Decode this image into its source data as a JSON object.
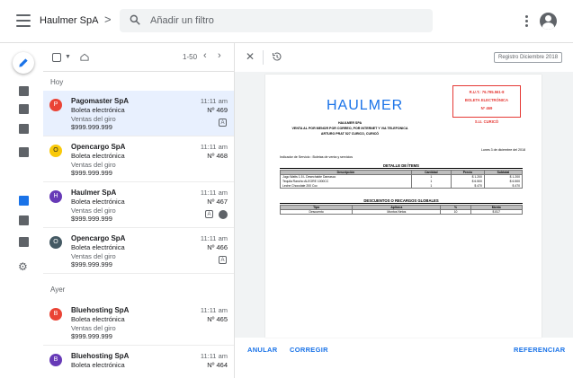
{
  "app": {
    "company": "Haulmer SpA",
    "breadcrumb_chevron": ">",
    "search_placeholder": "Añadir un filtro"
  },
  "colors": {
    "accent": "#1a73e8",
    "selected_row": "#e8f0fe",
    "doc_red": "#e53935"
  },
  "rail_icons": [
    "pencil-icon",
    "inbox-down-icon",
    "inbox-up-icon",
    "archive-icon",
    "report-icon",
    "document-folder-icon",
    "document-list-icon",
    "document-export-icon",
    "gear-icon"
  ],
  "list": {
    "pager": "1-50",
    "sections": [
      "Hoy",
      "Ayer"
    ],
    "items": [
      {
        "initial": "P",
        "sender": "Pagomaster SpA",
        "subject": "Boleta electrónica",
        "desc": "Ventas del giro",
        "amount": "$999.999.999",
        "time": "11:11 am",
        "num": "Nº 469",
        "color": "#ea4335",
        "badge": "A"
      },
      {
        "initial": "O",
        "sender": "Opencargo SpA",
        "subject": "Boleta electrónica",
        "desc": "Ventas del giro",
        "amount": "$999.999.999",
        "time": "11:11 am",
        "num": "Nº 468",
        "color": "#f9c909",
        "badge": ""
      },
      {
        "initial": "H",
        "sender": "Haulmer SpA",
        "subject": "Boleta electrónica",
        "desc": "Ventas del giro",
        "amount": "$999.999.999",
        "time": "11:11 am",
        "num": "Nº 467",
        "color": "#673ab7",
        "badge": "A"
      },
      {
        "initial": "O",
        "sender": "Opencargo SpA",
        "subject": "Boleta electrónica",
        "desc": "Ventas del giro",
        "amount": "$999.999.999",
        "time": "11:11 am",
        "num": "Nº 466",
        "color": "#455a64",
        "badge": "A"
      },
      {
        "initial": "B",
        "sender": "Bluehosting SpA",
        "subject": "Boleta electrónica",
        "desc": "Ventas del giro",
        "amount": "$999.999.999",
        "time": "11:11 am",
        "num": "Nº 465",
        "color": "#ea4335",
        "badge": ""
      },
      {
        "initial": "B",
        "sender": "Bluehosting SpA",
        "subject": "Boleta electrónica",
        "desc": "",
        "amount": "",
        "time": "11:11 am",
        "num": "Nº 464",
        "color": "#673ab7",
        "badge": ""
      }
    ]
  },
  "detail": {
    "registro": "Registro Diciembre 2018",
    "actions": {
      "anular": "ANULAR",
      "corregir": "CORREGIR",
      "referenciar": "REFERENCIAR"
    }
  },
  "doc": {
    "logo": "HAULMER",
    "rut": "R.U.T.: 76.795.561-8",
    "tipo": "Boleta ELECTRÓNICA",
    "numero": "Nº 469",
    "sii": "S.I.I. CURICÓ",
    "issuer_name": "HAULMER SPA",
    "issuer_line1": "VENTA AL POR MENOR POR CORREO, POR INTERNET Y VIA TELEFONICA",
    "issuer_line2": "ARTURO PRAT 527 CURICO, CURICÓ",
    "fecha": "Lunes 3 de diciembre del 2018",
    "indicador": "Indicador de Servicio : Boletas de venta y servicios",
    "detalle_title": "DETALLE DE ÍTEMS",
    "detalle_headers": [
      "Descripción",
      "Cantidad",
      "Precio",
      "Subtotal"
    ],
    "detalle_rows": [
      [
        "Jugo Watts 1.5 L Desechable Damasco",
        "1",
        "$ 1.200",
        "$ 1.200"
      ],
      [
        "Tequila Rancho ALEGRE 1000CC",
        "1",
        "$ 6.500",
        "$ 6.500"
      ],
      [
        "Leche Chocolate 200 Ccc",
        "1",
        "$ 470",
        "$ 470"
      ]
    ],
    "descuentos_title": "DESCUENTOS O RECARGOS GLOBALES",
    "descuentos_headers": [
      "Tipo",
      "Aplica a",
      "%",
      "Monto"
    ],
    "descuentos_rows": [
      [
        "Descuento",
        "Montos Netos",
        "10",
        "$ 817"
      ]
    ]
  }
}
